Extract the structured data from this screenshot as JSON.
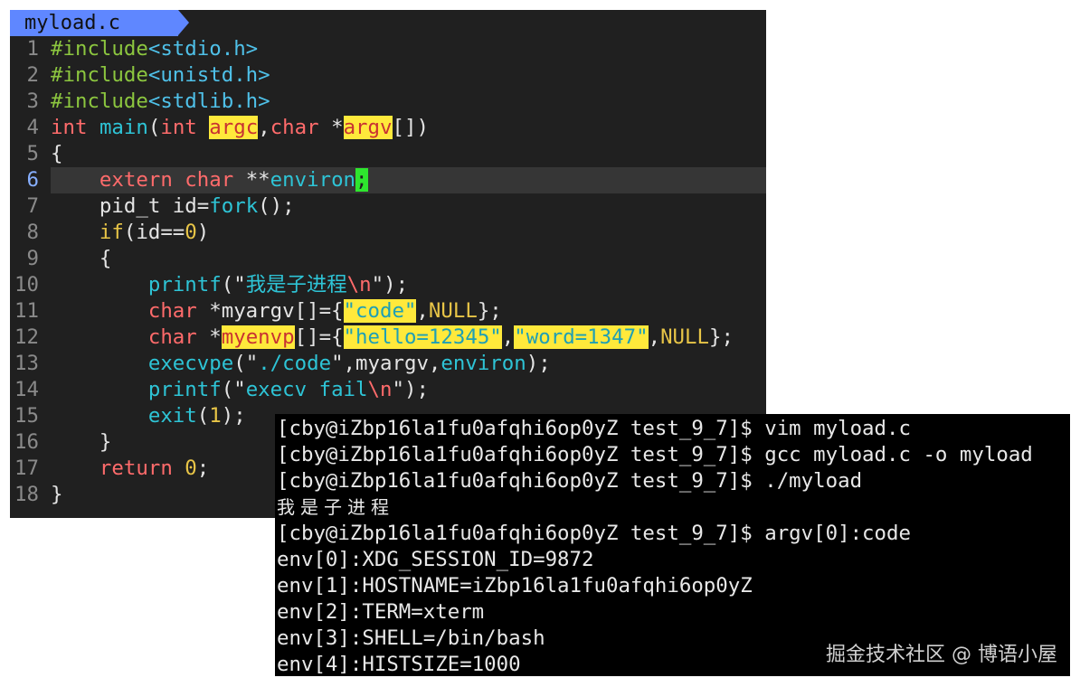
{
  "editor": {
    "tab_name": "myload.c",
    "cursor_line": 6,
    "lines": [
      {
        "n": "1",
        "parts": [
          {
            "t": "#include",
            "c": "pp"
          },
          {
            "t": "<stdio.h>",
            "c": "inc"
          }
        ]
      },
      {
        "n": "2",
        "parts": [
          {
            "t": "#include",
            "c": "pp"
          },
          {
            "t": "<unistd.h>",
            "c": "inc"
          }
        ]
      },
      {
        "n": "3",
        "parts": [
          {
            "t": "#include",
            "c": "pp"
          },
          {
            "t": "<stdlib.h>",
            "c": "inc"
          }
        ]
      },
      {
        "n": "4",
        "parts": [
          {
            "t": "int",
            "c": "type"
          },
          {
            "t": " "
          },
          {
            "t": "main",
            "c": "fn"
          },
          {
            "t": "("
          },
          {
            "t": "int",
            "c": "type"
          },
          {
            "t": " "
          },
          {
            "t": "argc",
            "c": "hl"
          },
          {
            "t": ","
          },
          {
            "t": "char",
            "c": "type"
          },
          {
            "t": " *"
          },
          {
            "t": "argv",
            "c": "hl"
          },
          {
            "t": "[])"
          }
        ]
      },
      {
        "n": "5",
        "parts": [
          {
            "t": "{"
          }
        ]
      },
      {
        "n": "6",
        "parts": [
          {
            "t": "    "
          },
          {
            "t": "extern",
            "c": "type"
          },
          {
            "t": " "
          },
          {
            "t": "char",
            "c": "type"
          },
          {
            "t": " **"
          },
          {
            "t": "environ",
            "c": "fn"
          },
          {
            "t": ";",
            "c": "cursor"
          }
        ]
      },
      {
        "n": "7",
        "parts": [
          {
            "t": "    pid_t id="
          },
          {
            "t": "fork",
            "c": "fn"
          },
          {
            "t": "();"
          }
        ]
      },
      {
        "n": "8",
        "parts": [
          {
            "t": "    "
          },
          {
            "t": "if",
            "c": "kw"
          },
          {
            "t": "(id=="
          },
          {
            "t": "0",
            "c": "num"
          },
          {
            "t": ")"
          }
        ]
      },
      {
        "n": "9",
        "parts": [
          {
            "t": "    {"
          }
        ]
      },
      {
        "n": "10",
        "parts": [
          {
            "t": "        "
          },
          {
            "t": "printf",
            "c": "fn"
          },
          {
            "t": "(\""
          },
          {
            "t": "我是子进程",
            "c": "str"
          },
          {
            "t": "\\n",
            "c": "esc"
          },
          {
            "t": "\");"
          }
        ]
      },
      {
        "n": "11",
        "parts": [
          {
            "t": "        "
          },
          {
            "t": "char",
            "c": "type"
          },
          {
            "t": " *myargv[]={"
          },
          {
            "t": "\"code\"",
            "c": "hls"
          },
          {
            "t": ","
          },
          {
            "t": "NULL",
            "c": "nul"
          },
          {
            "t": "};"
          }
        ]
      },
      {
        "n": "12",
        "parts": [
          {
            "t": "        "
          },
          {
            "t": "char",
            "c": "type"
          },
          {
            "t": " *"
          },
          {
            "t": "myenvp",
            "c": "hl"
          },
          {
            "t": "[]={"
          },
          {
            "t": "\"hello=12345\"",
            "c": "hls"
          },
          {
            "t": ","
          },
          {
            "t": "\"word=1347\"",
            "c": "hls"
          },
          {
            "t": ","
          },
          {
            "t": "NULL",
            "c": "nul"
          },
          {
            "t": "};"
          }
        ]
      },
      {
        "n": "13",
        "parts": [
          {
            "t": "        "
          },
          {
            "t": "execvpe",
            "c": "fn"
          },
          {
            "t": "(\""
          },
          {
            "t": "./code",
            "c": "str"
          },
          {
            "t": "\",myargv,"
          },
          {
            "t": "environ",
            "c": "fn"
          },
          {
            "t": ");"
          }
        ]
      },
      {
        "n": "14",
        "parts": [
          {
            "t": "        "
          },
          {
            "t": "printf",
            "c": "fn"
          },
          {
            "t": "(\""
          },
          {
            "t": "execv fail",
            "c": "str"
          },
          {
            "t": "\\n",
            "c": "esc"
          },
          {
            "t": "\");"
          }
        ]
      },
      {
        "n": "15",
        "parts": [
          {
            "t": "        "
          },
          {
            "t": "exit",
            "c": "fn"
          },
          {
            "t": "("
          },
          {
            "t": "1",
            "c": "num"
          },
          {
            "t": ");"
          }
        ]
      },
      {
        "n": "16",
        "parts": [
          {
            "t": "    }"
          }
        ]
      },
      {
        "n": "17",
        "parts": [
          {
            "t": "    "
          },
          {
            "t": "return",
            "c": "type"
          },
          {
            "t": " "
          },
          {
            "t": "0",
            "c": "num"
          },
          {
            "t": ";"
          }
        ]
      },
      {
        "n": "18",
        "parts": [
          {
            "t": "}"
          }
        ]
      }
    ]
  },
  "terminal": {
    "lines": [
      "[cby@iZbp16la1fu0afqhi6op0yZ test_9_7]$ vim myload.c",
      "[cby@iZbp16la1fu0afqhi6op0yZ test_9_7]$ gcc myload.c -o myload",
      "[cby@iZbp16la1fu0afqhi6op0yZ test_9_7]$ ./myload",
      "我是子进程",
      "[cby@iZbp16la1fu0afqhi6op0yZ test_9_7]$ argv[0]:code",
      "env[0]:XDG_SESSION_ID=9872",
      "env[1]:HOSTNAME=iZbp16la1fu0afqhi6op0yZ",
      "env[2]:TERM=xterm",
      "env[3]:SHELL=/bin/bash",
      "env[4]:HISTSIZE=1000"
    ]
  },
  "watermark": "掘金技术社区 @ 博语小屋",
  "colors": {
    "editor_bg": "#202020",
    "tab_bg": "#5f87ff",
    "terminal_bg": "#000000",
    "highlight": "#ffe93b",
    "cursor": "#2ee62e"
  }
}
